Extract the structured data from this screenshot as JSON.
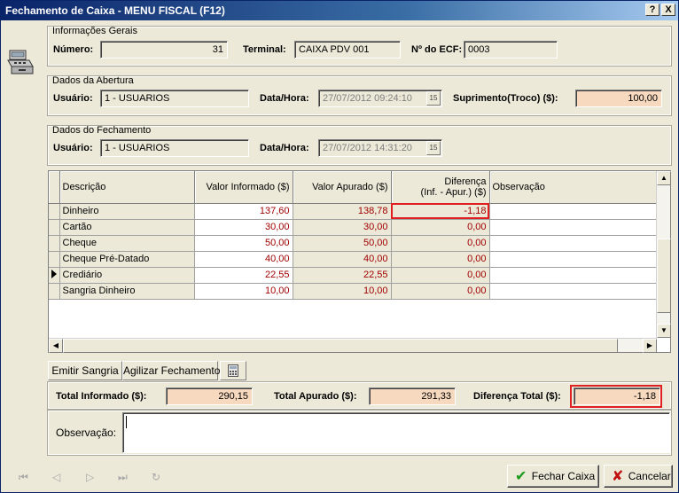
{
  "window": {
    "title": "Fechamento de Caixa - MENU FISCAL (F12)",
    "help_label": "?",
    "close_label": "X"
  },
  "gerais": {
    "title": "Informações Gerais",
    "numero_label": "Número:",
    "numero_value": "31",
    "terminal_label": "Terminal:",
    "terminal_value": "CAIXA PDV 001",
    "ecf_label": "Nº do ECF:",
    "ecf_value": "0003"
  },
  "abertura": {
    "title": "Dados da Abertura",
    "usuario_label": "Usuário:",
    "usuario_value": "1 - USUARIOS",
    "datahora_label": "Data/Hora:",
    "datahora_value": "27/07/2012 09:24:10",
    "suprimento_label": "Suprimento(Troco) ($):",
    "suprimento_value": "100,00"
  },
  "fechamento": {
    "title": "Dados do Fechamento",
    "usuario_label": "Usuário:",
    "usuario_value": "1 - USUARIOS",
    "datahora_label": "Data/Hora:",
    "datahora_value": "27/07/2012 14:31:20"
  },
  "grid": {
    "headers": {
      "descricao": "Descrição",
      "valor_informado": "Valor Informado ($)",
      "valor_apurado": "Valor Apurado ($)",
      "diferenca_1": "Diferença",
      "diferenca_2": "(Inf. - Apur.) ($)",
      "observacao": "Observação"
    },
    "rows": [
      {
        "descricao": "Dinheiro",
        "informado": "137,60",
        "apurado": "138,78",
        "diferenca": "-1,18",
        "observacao": ""
      },
      {
        "descricao": "Cartão",
        "informado": "30,00",
        "apurado": "30,00",
        "diferenca": "0,00",
        "observacao": ""
      },
      {
        "descricao": "Cheque",
        "informado": "50,00",
        "apurado": "50,00",
        "diferenca": "0,00",
        "observacao": ""
      },
      {
        "descricao": "Cheque Pré-Datado",
        "informado": "40,00",
        "apurado": "40,00",
        "diferenca": "0,00",
        "observacao": ""
      },
      {
        "descricao": "Crediário",
        "informado": "22,55",
        "apurado": "22,55",
        "diferenca": "0,00",
        "observacao": ""
      },
      {
        "descricao": "Sangria Dinheiro",
        "informado": "10,00",
        "apurado": "10,00",
        "diferenca": "0,00",
        "observacao": ""
      }
    ],
    "selected_row": 4
  },
  "toolbar": {
    "emitir_sangria": "Emitir Sangria",
    "agilizar_fechamento": "Agilizar Fechamento"
  },
  "totais": {
    "informado_label": "Total Informado ($):",
    "informado_value": "290,15",
    "apurado_label": "Total Apurado ($):",
    "apurado_value": "291,33",
    "diferenca_label": "Diferença Total ($):",
    "diferenca_value": "-1,18"
  },
  "observacao": {
    "label": "Observação:",
    "value": ""
  },
  "actions": {
    "fechar_caixa": "Fechar Caixa",
    "cancelar": "Cancelar"
  },
  "colors": {
    "highlight": "#e02020",
    "peach_field": "#f7d9bf",
    "value_red": "#a00000",
    "title_bar": "#0a246a"
  }
}
